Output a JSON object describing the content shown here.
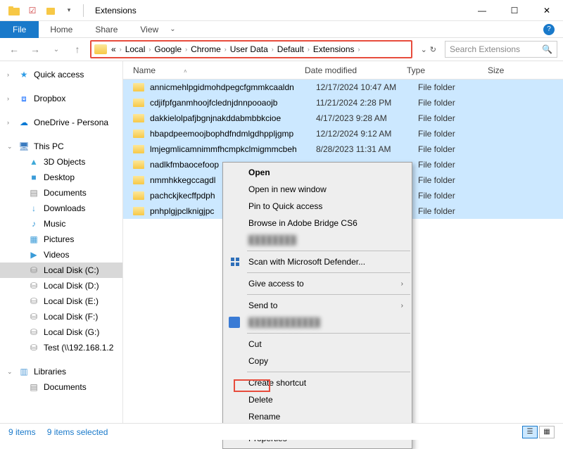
{
  "window": {
    "title": "Extensions"
  },
  "tabs": {
    "file": "File",
    "home": "Home",
    "share": "Share",
    "view": "View"
  },
  "breadcrumb": [
    "Local",
    "Google",
    "Chrome",
    "User Data",
    "Default",
    "Extensions"
  ],
  "search": {
    "placeholder": "Search Extensions"
  },
  "columns": {
    "name": "Name",
    "date": "Date modified",
    "type": "Type",
    "size": "Size"
  },
  "nav": {
    "quick_access": "Quick access",
    "dropbox": "Dropbox",
    "onedrive": "OneDrive - Persona",
    "this_pc": "This PC",
    "objects3d": "3D Objects",
    "desktop": "Desktop",
    "documents": "Documents",
    "downloads": "Downloads",
    "music": "Music",
    "pictures": "Pictures",
    "videos": "Videos",
    "local_c": "Local Disk (C:)",
    "local_d": "Local Disk (D:)",
    "local_e": "Local Disk (E:)",
    "local_f": "Local Disk (F:)",
    "local_g": "Local Disk (G:)",
    "test": "Test (\\\\192.168.1.2",
    "libraries": "Libraries",
    "lib_documents": "Documents"
  },
  "files": [
    {
      "name": "annicmehlpgidmohdpegcfgmmkcaaldn",
      "date": "12/17/2024 10:47 AM",
      "type": "File folder"
    },
    {
      "name": "cdjifpfganmhoojfclednjdnnpooaojb",
      "date": "11/21/2024 2:28 PM",
      "type": "File folder"
    },
    {
      "name": "dakkielolpafjbgnjnakddabmbbkcioe",
      "date": "4/17/2023 9:28 AM",
      "type": "File folder"
    },
    {
      "name": "hbapdpeemoojbophdfndmlgdhppljgmp",
      "date": "12/12/2024 9:12 AM",
      "type": "File folder"
    },
    {
      "name": "lmjegmlicamnimmfhcmpkclmigmmcbeh",
      "date": "8/28/2023 11:31 AM",
      "type": "File folder"
    },
    {
      "name": "nadlkfmbaocefoop",
      "date": "",
      "type": "File folder"
    },
    {
      "name": "nmmhkkegccagdl",
      "date": "",
      "type": "File folder"
    },
    {
      "name": "pachckjkecffpdph",
      "date": "",
      "type": "File folder"
    },
    {
      "name": "pnhplgjpclknigjpc",
      "date": "",
      "type": "File folder"
    }
  ],
  "context_menu": {
    "open": "Open",
    "open_new_window": "Open in new window",
    "pin_quick": "Pin to Quick access",
    "bridge": "Browse in Adobe Bridge CS6",
    "defender": "Scan with Microsoft Defender...",
    "give_access": "Give access to",
    "send_to": "Send to",
    "cut": "Cut",
    "copy": "Copy",
    "shortcut": "Create shortcut",
    "delete": "Delete",
    "rename": "Rename",
    "properties": "Properties"
  },
  "status": {
    "items": "9 items",
    "selected": "9 items selected"
  }
}
